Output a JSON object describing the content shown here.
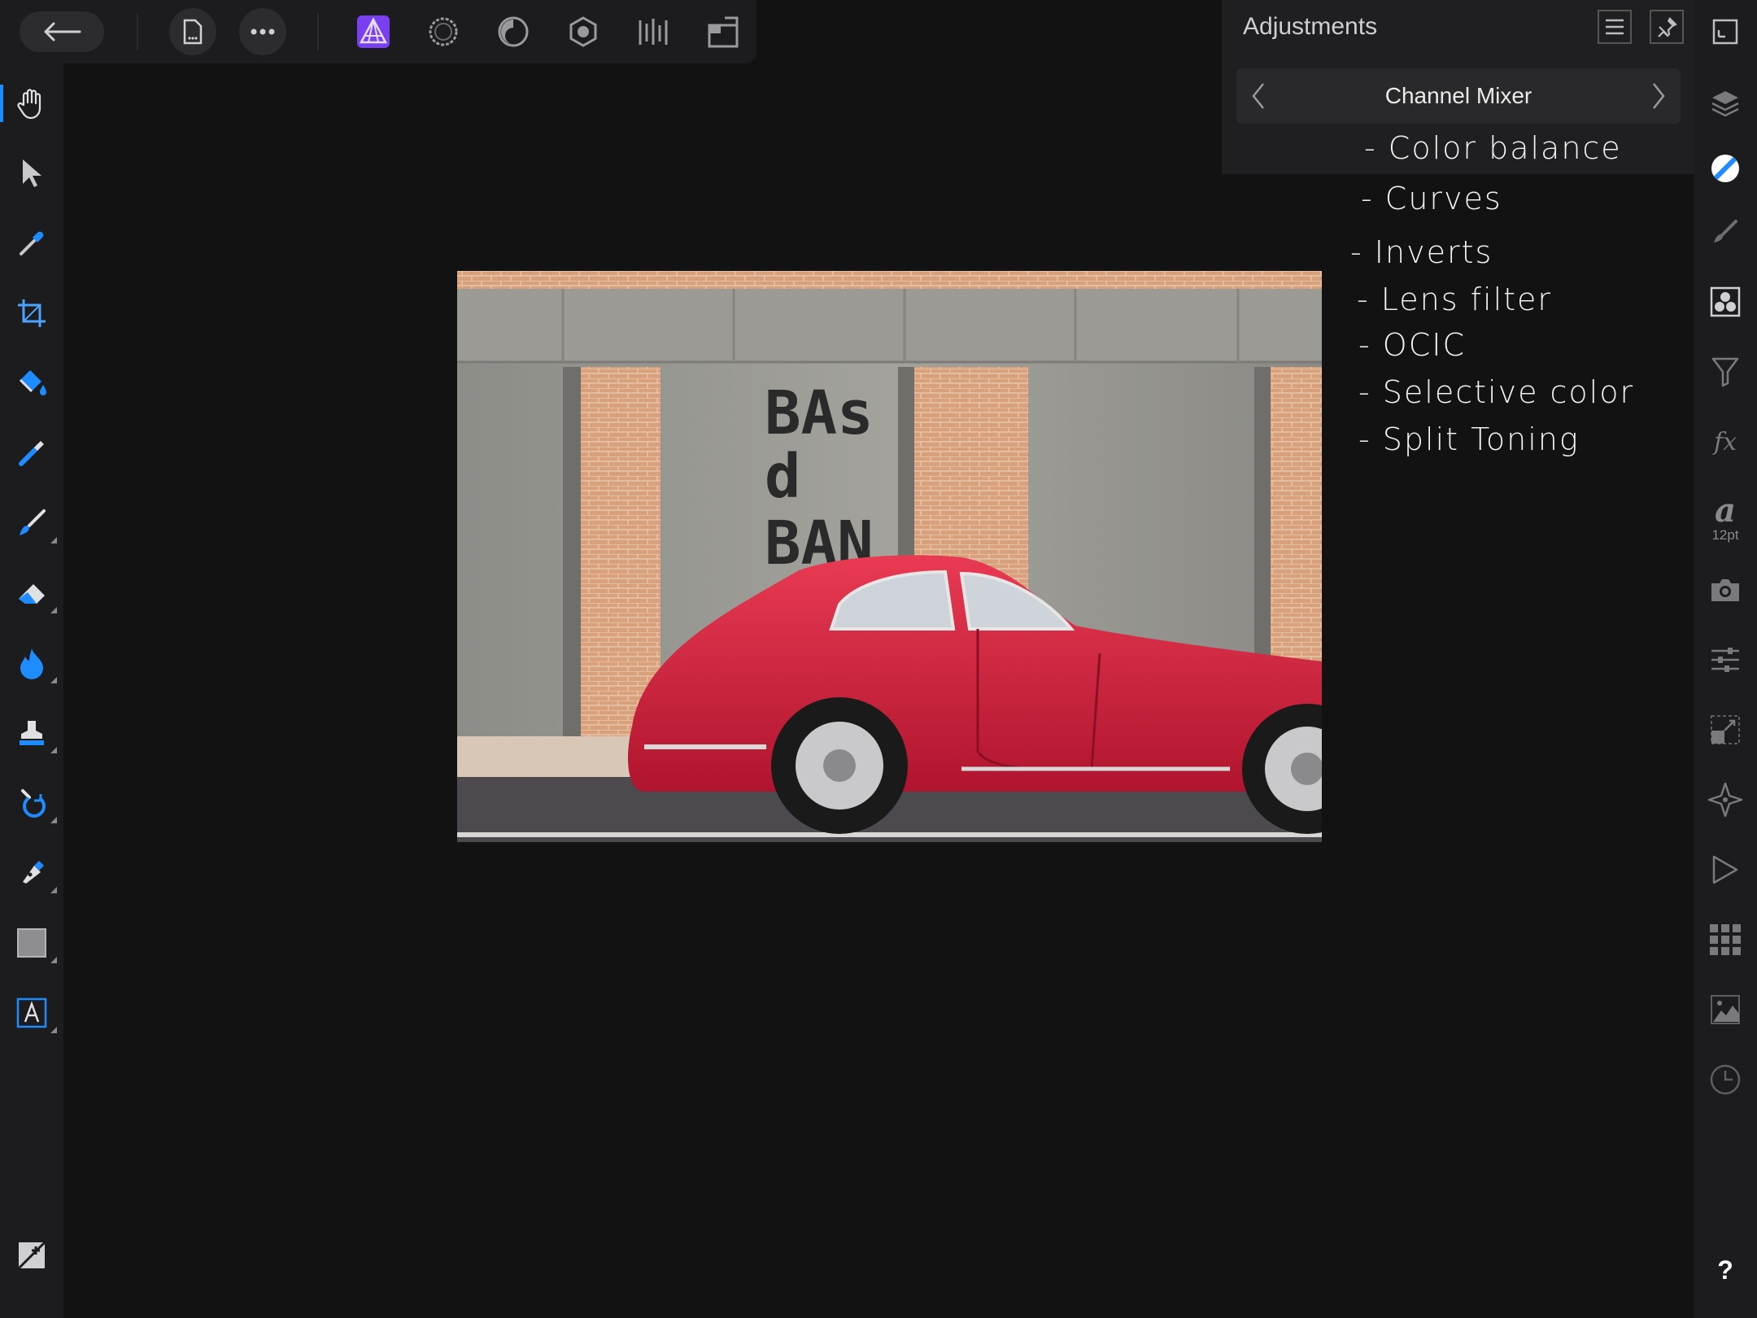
{
  "adjustments_panel": {
    "title": "Adjustments",
    "current_preset": "Channel Mixer"
  },
  "handwritten_note": {
    "lines": [
      "- Color balance",
      "- Curves",
      "- Inverts",
      "- Lens filter",
      "- OCIC",
      "- Selective color",
      "- Split Toning"
    ]
  },
  "canvas": {
    "sign_lines": [
      "BAs",
      "d",
      "BAN"
    ]
  },
  "right_studio": {
    "text_size_label": "12pt",
    "help_label": "?"
  },
  "colors": {
    "accent_purple": "#7b3ff2",
    "accent_blue": "#1e8cff",
    "car_red": "#d81e3c",
    "background": "#121212",
    "panel": "#1f1f21"
  },
  "icons": {
    "top": [
      "back-arrow-icon",
      "document-icon",
      "more-icon",
      "photo-persona-icon",
      "liquify-persona-icon",
      "develop-persona-icon",
      "tone-mapping-persona-icon",
      "export-persona-icon",
      "layout-icon"
    ],
    "left": [
      "hand-icon",
      "move-icon",
      "color-picker-icon",
      "crop-icon",
      "flood-fill-icon",
      "selection-brush-icon",
      "paint-brush-icon",
      "eraser-icon",
      "dodge-burn-icon",
      "clone-stamp-icon",
      "healing-icon",
      "pen-icon",
      "rectangle-icon",
      "text-icon",
      "add-layer-icon"
    ],
    "right": [
      "canvas-fit-icon",
      "layers-icon",
      "adjustments-icon",
      "brushes-icon",
      "channels-icon",
      "filters-icon",
      "fx-icon",
      "text-style-icon",
      "snapshots-icon",
      "settings-sliders-icon",
      "transform-icon",
      "navigator-icon",
      "macro-play-icon",
      "swatches-icon",
      "histogram-icon",
      "history-icon",
      "help-icon"
    ]
  }
}
